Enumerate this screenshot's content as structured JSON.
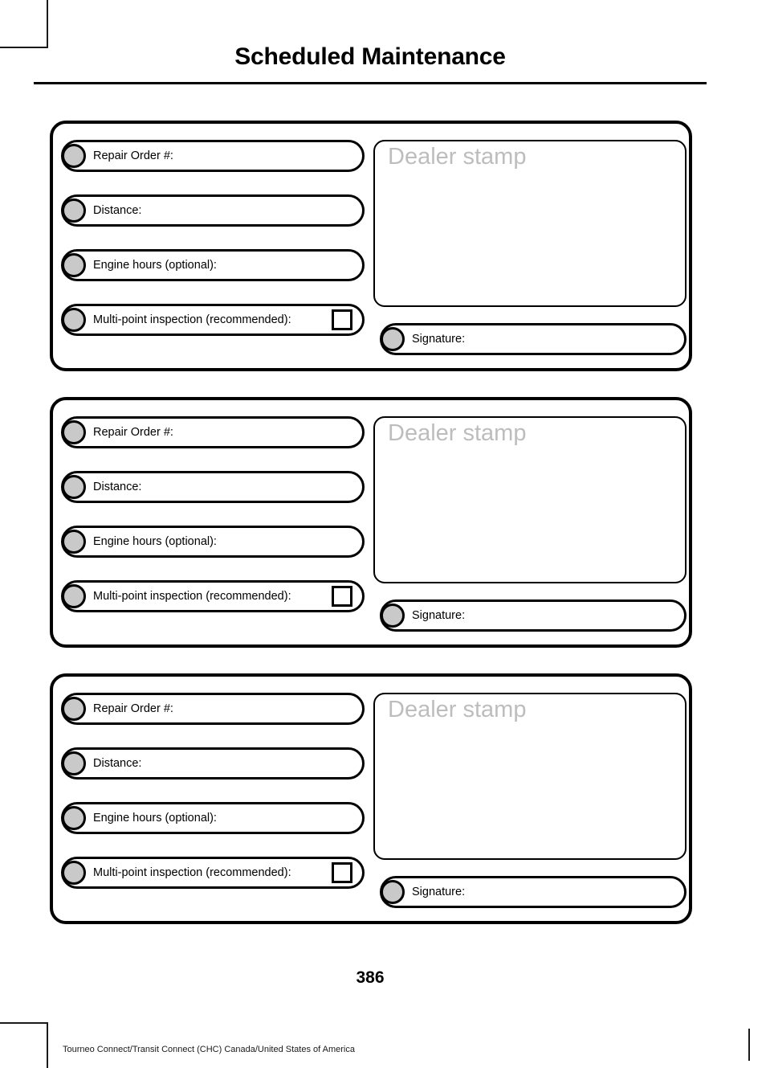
{
  "header": {
    "title": "Scheduled Maintenance"
  },
  "cards": [
    {
      "fields": [
        {
          "label": "Repair Order #:",
          "checkbox": false
        },
        {
          "label": "Distance:",
          "checkbox": false
        },
        {
          "label": "Engine hours (optional):",
          "checkbox": false
        },
        {
          "label": "Multi-point inspection (recommended):",
          "checkbox": true
        }
      ],
      "stamp_label": "Dealer stamp",
      "signature_label": "Signature:"
    },
    {
      "fields": [
        {
          "label": "Repair Order #:",
          "checkbox": false
        },
        {
          "label": "Distance:",
          "checkbox": false
        },
        {
          "label": "Engine hours (optional):",
          "checkbox": false
        },
        {
          "label": "Multi-point inspection (recommended):",
          "checkbox": true
        }
      ],
      "stamp_label": "Dealer stamp",
      "signature_label": "Signature:"
    },
    {
      "fields": [
        {
          "label": "Repair Order #:",
          "checkbox": false
        },
        {
          "label": "Distance:",
          "checkbox": false
        },
        {
          "label": "Engine hours (optional):",
          "checkbox": false
        },
        {
          "label": "Multi-point inspection (recommended):",
          "checkbox": true
        }
      ],
      "stamp_label": "Dealer stamp",
      "signature_label": "Signature:"
    }
  ],
  "footer": {
    "page_number": "386",
    "note": "Tourneo Connect/Transit Connect (CHC) Canada/United States of America"
  },
  "colors": {
    "ink": "#000000",
    "bullet_fill": "#c9c9c9",
    "stamp_text": "#bdbdbd"
  }
}
